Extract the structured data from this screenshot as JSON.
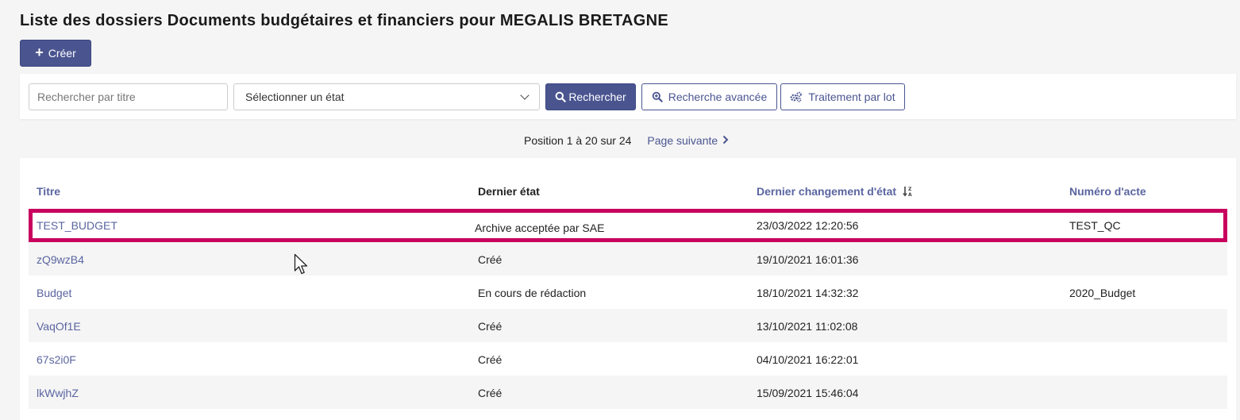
{
  "page": {
    "title": "Liste des dossiers Documents budgétaires et financiers pour MEGALIS BRETAGNE",
    "create_label": "Créer"
  },
  "search": {
    "title_placeholder": "Rechercher par titre",
    "state_select_value": "Sélectionner un état",
    "search_label": "Rechercher",
    "advanced_label": "Recherche avancée",
    "batch_label": "Traitement par lot"
  },
  "pagination": {
    "position_text": "Position 1 à 20 sur 24",
    "next_label": "Page suivante"
  },
  "table": {
    "columns": [
      "Titre",
      "Dernier état",
      "Dernier changement d'état",
      "Numéro d'acte"
    ],
    "rows": [
      {
        "titre": "TEST_BUDGET",
        "etat": "Archive acceptée par SAE",
        "date": "23/03/2022 12:20:56",
        "acte": "TEST_QC"
      },
      {
        "titre": "zQ9wzB4",
        "etat": "Créé",
        "date": "19/10/2021 16:01:36",
        "acte": ""
      },
      {
        "titre": "Budget",
        "etat": "En cours de rédaction",
        "date": "18/10/2021 14:32:32",
        "acte": "2020_Budget"
      },
      {
        "titre": "VaqOf1E",
        "etat": "Créé",
        "date": "13/10/2021 11:02:08",
        "acte": ""
      },
      {
        "titre": "67s2i0F",
        "etat": "Créé",
        "date": "04/10/2021 16:22:01",
        "acte": ""
      },
      {
        "titre": "lkWwjhZ",
        "etat": "Créé",
        "date": "15/09/2021 15:46:04",
        "acte": ""
      }
    ]
  },
  "colors": {
    "primary": "#4a5590",
    "link": "#5a65a0",
    "highlight": "#c8005e"
  }
}
